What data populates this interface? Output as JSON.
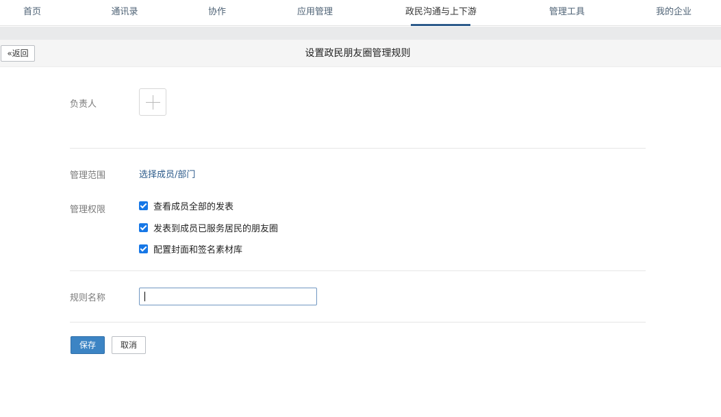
{
  "nav": {
    "items": [
      {
        "label": "首页"
      },
      {
        "label": "通讯录"
      },
      {
        "label": "协作"
      },
      {
        "label": "应用管理"
      },
      {
        "label": "政民沟通与上下游"
      },
      {
        "label": "管理工具"
      },
      {
        "label": "我的企业"
      }
    ],
    "active_index": 4
  },
  "header": {
    "back_label": "«返回",
    "title": "设置政民朋友圈管理规则"
  },
  "form": {
    "owner_label": "负责人",
    "owner_add_icon": "plus-icon",
    "scope_label": "管理范围",
    "scope_link": "选择成员/部门",
    "permission_label": "管理权限",
    "permissions": [
      {
        "label": "查看成员全部的发表",
        "checked": true
      },
      {
        "label": "发表到成员已服务居民的朋友圈",
        "checked": true
      },
      {
        "label": "配置封面和签名素材库",
        "checked": true
      }
    ],
    "rule_name_label": "规则名称",
    "rule_name_value": ""
  },
  "actions": {
    "save_label": "保存",
    "cancel_label": "取消"
  },
  "colors": {
    "accent": "#2b5a8a",
    "checkbox": "#1677e6",
    "save_button": "#3c84c4"
  }
}
